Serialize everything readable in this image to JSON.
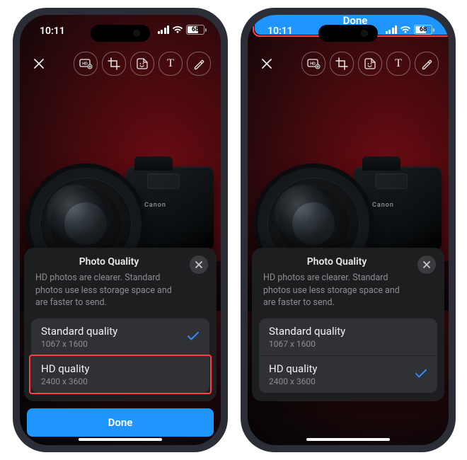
{
  "status": {
    "time": "10:11",
    "battery": "68"
  },
  "toolbar": {
    "close_icon": "close",
    "buttons": [
      "hd",
      "crop",
      "sticker",
      "text",
      "draw"
    ]
  },
  "photo": {
    "brand": "Canon"
  },
  "sheet": {
    "title": "Photo Quality",
    "subtitle": "HD photos are clearer. Standard photos use less storage space and are faster to send.",
    "options": [
      {
        "title": "Standard quality",
        "sub": "1067 x 1600"
      },
      {
        "title": "HD quality",
        "sub": "2400 x 3600"
      }
    ],
    "done": "Done"
  },
  "screens": [
    {
      "selected_index": 0,
      "highlight": "option-1"
    },
    {
      "selected_index": 1,
      "highlight": "done"
    }
  ]
}
